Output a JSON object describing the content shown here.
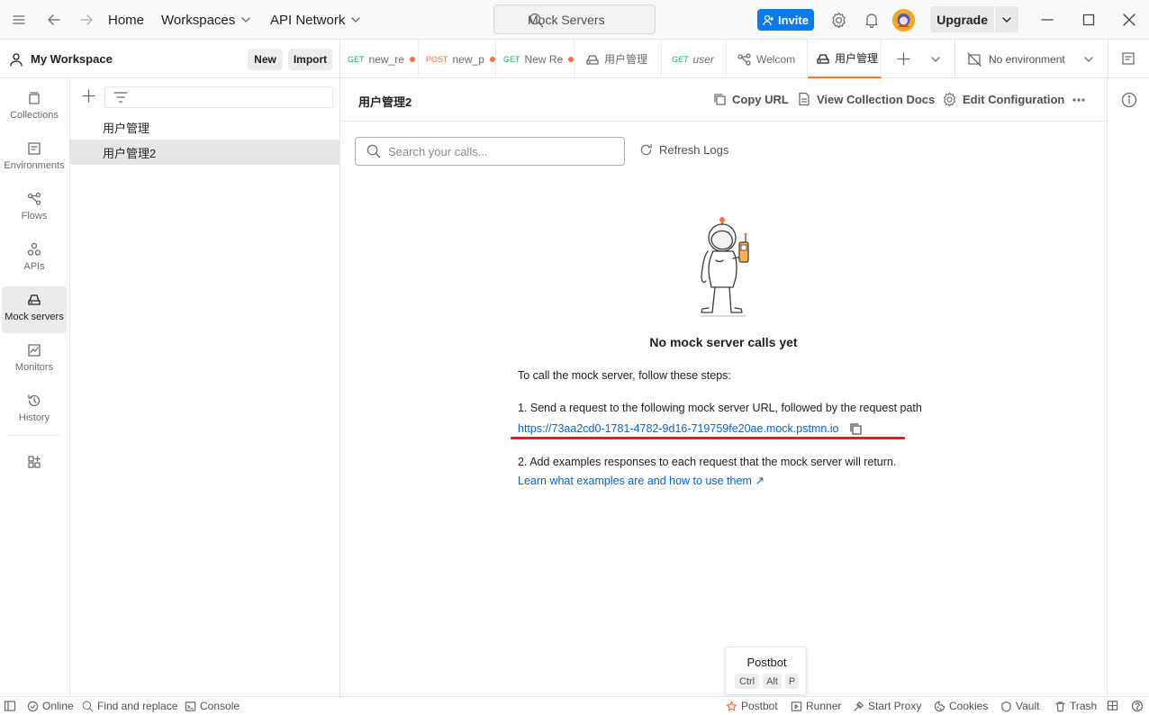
{
  "topbar": {
    "nav": {
      "home": "Home",
      "workspaces": "Workspaces",
      "api_network": "API Network"
    },
    "search_placeholder": "Mock Servers",
    "invite_label": "Invite",
    "upgrade_label": "Upgrade"
  },
  "workspace": {
    "name": "My Workspace",
    "new_label": "New",
    "import_label": "Import"
  },
  "tabs": [
    {
      "method": "GET",
      "label": "new_re",
      "method_color": "#0cbb52",
      "unsaved": true
    },
    {
      "method": "POST",
      "label": "new_p",
      "method_color": "#ff6c37",
      "unsaved": true
    },
    {
      "method": "GET",
      "label": "New Re",
      "method_color": "#0cbb52",
      "unsaved": true
    },
    {
      "label": "用户管理"
    },
    {
      "method": "GET",
      "label": "user",
      "method_color": "#0cbb52"
    },
    {
      "label": "Welcom"
    },
    {
      "label": "用户管理"
    }
  ],
  "environment": {
    "label": "No environment"
  },
  "rail": {
    "collections": "Collections",
    "environments": "Environments",
    "flows": "Flows",
    "apis": "APIs",
    "mock_servers": "Mock servers",
    "monitors": "Monitors",
    "history": "History"
  },
  "sidebar": {
    "items": [
      "用户管理",
      "用户管理2"
    ]
  },
  "main": {
    "title": "用户管理2",
    "copy_url": "Copy URL",
    "view_docs": "View Collection Docs",
    "edit_config": "Edit Configuration",
    "search_placeholder": "Search your calls...",
    "refresh_label": "Refresh Logs",
    "empty_title": "No mock server calls yet",
    "intro": "To call the mock server, follow these steps:",
    "step1": "1. Send a request to the following mock server URL, followed by the request path",
    "mock_url": "https://73aa2cd0-1781-4782-9d16-719759fe20ae.mock.pstmn.io",
    "step2": "2. Add examples responses to each request that the mock server will return.",
    "learn_link": "Learn what examples are and how to use them ↗"
  },
  "postbot_tip": {
    "title": "Postbot",
    "keys": [
      "Ctrl",
      "Alt",
      "P"
    ]
  },
  "statusbar": {
    "online": "Online",
    "find_replace": "Find and replace",
    "console": "Console",
    "postbot": "Postbot",
    "runner": "Runner",
    "start_proxy": "Start Proxy",
    "cookies": "Cookies",
    "vault": "Vault",
    "trash": "Trash"
  },
  "colors": {
    "accent": "#ff6c37",
    "invite": "#097bed",
    "link": "#0265d2",
    "highlight": "#e81c1c"
  }
}
